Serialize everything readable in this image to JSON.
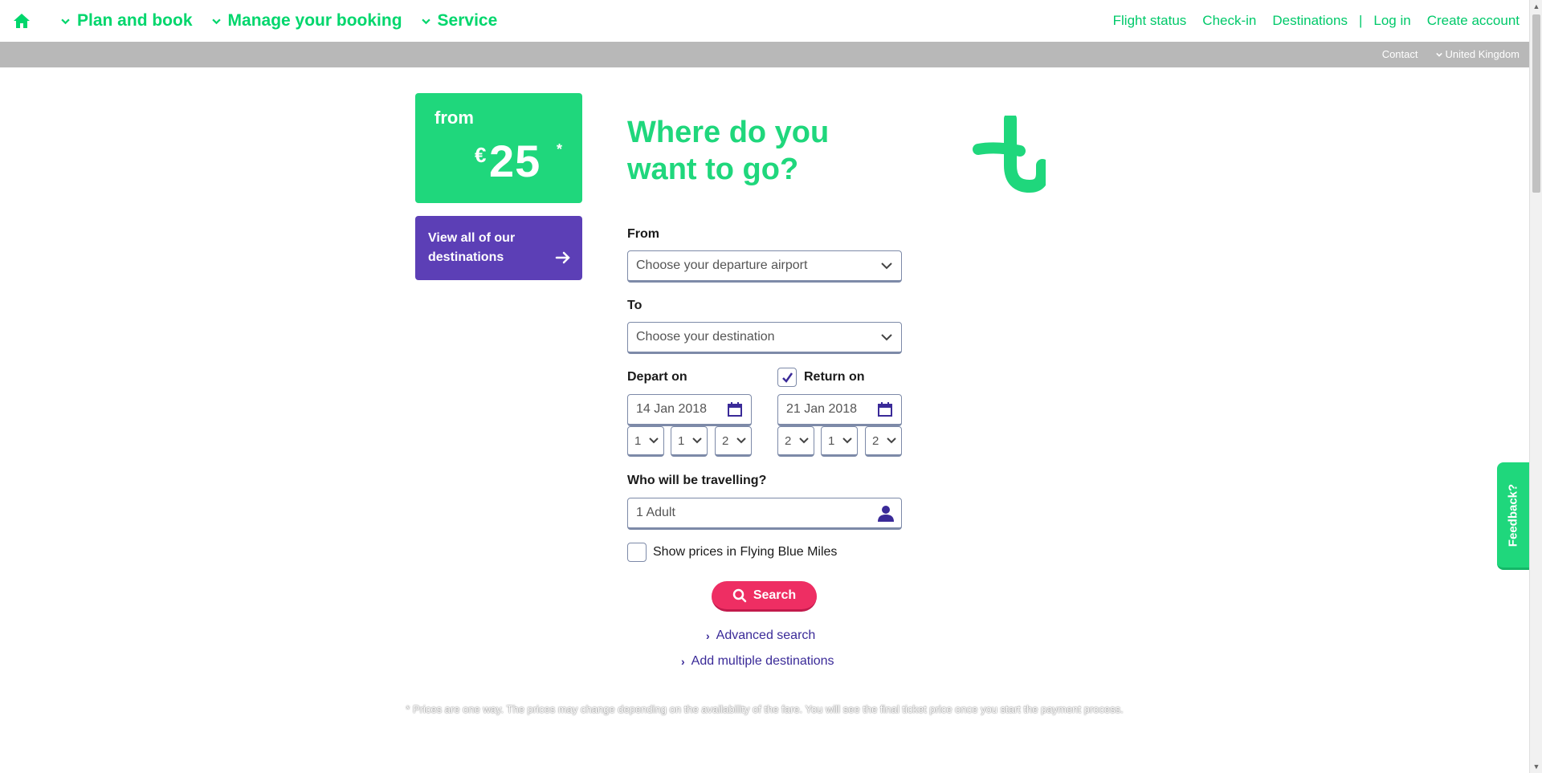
{
  "nav": {
    "home_icon": "home-icon",
    "menu": [
      {
        "label": "Plan and book"
      },
      {
        "label": "Manage your booking"
      },
      {
        "label": "Service"
      }
    ],
    "right_links": [
      "Flight status",
      "Check-in",
      "Destinations"
    ],
    "separator": "|",
    "login": "Log in",
    "create_account": "Create account"
  },
  "subbar": {
    "contact": "Contact",
    "country": "United Kingdom"
  },
  "promo": {
    "from": "from",
    "currency": "€",
    "price": "25",
    "asterisk": "*"
  },
  "destinations_button": "View all of our destinations",
  "heading": "Where do you want to go?",
  "form": {
    "from_label": "From",
    "from_placeholder": "Choose your departure airport",
    "to_label": "To",
    "to_placeholder": "Choose your destination",
    "depart_label": "Depart on",
    "depart_date": "14 Jan 2018",
    "depart_day": "1",
    "depart_month": "1",
    "depart_year": "2",
    "return_checked": true,
    "return_label": "Return on",
    "return_date": "21 Jan 2018",
    "return_day": "2",
    "return_month": "1",
    "return_year": "2",
    "travellers_label": "Who will be travelling?",
    "travellers_value": "1 Adult",
    "miles_label": "Show prices in Flying Blue Miles",
    "search_label": "Search",
    "advanced_search": "Advanced search",
    "multi_dest": "Add multiple destinations"
  },
  "disclaimer": "* Prices are one way. The prices may change depending on the availability of the fare. You will see the final ticket price once you start the payment process.",
  "feedback": "Feedback?",
  "colors": {
    "brand_green": "#1fd77c",
    "brand_purple": "#5c3fb6",
    "search_pink": "#ee2e63"
  }
}
